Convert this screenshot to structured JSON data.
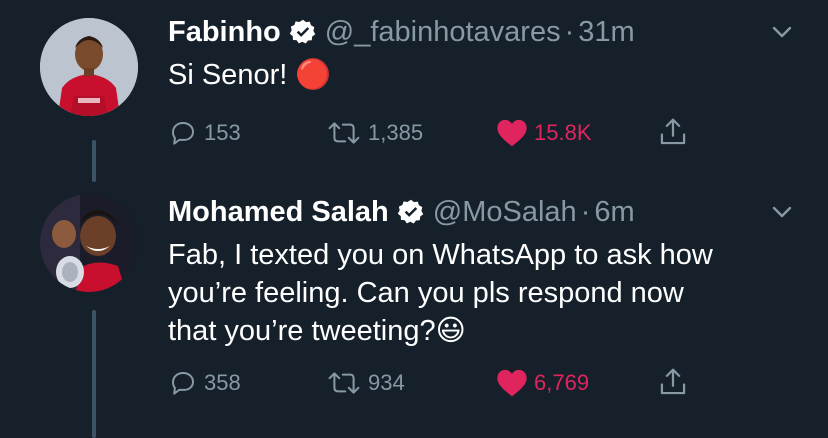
{
  "tweets": [
    {
      "name": "Fabinho",
      "handle": "@_fabinhotavares",
      "time": "31m",
      "text": "Si Senor! 🔴",
      "replies": "153",
      "retweets": "1,385",
      "likes": "15.8K"
    },
    {
      "name": "Mohamed Salah",
      "handle": "@MoSalah",
      "time": "6m",
      "text_lines": [
        "Fab, I texted you on WhatsApp to ask how",
        "you’re feeling. Can you pls respond now",
        "that you’re tweeting?😃"
      ],
      "replies": "358",
      "retweets": "934",
      "likes": "6,769"
    }
  ],
  "separator": "·",
  "colors": {
    "background": "#15202b",
    "secondary_text": "#8899a6",
    "like": "#e0245e",
    "verified": "#ffffff",
    "thread_line": "#3d5466"
  },
  "icons": [
    "verified-badge-icon",
    "chevron-down-icon",
    "reply-icon",
    "retweet-icon",
    "heart-icon",
    "share-icon"
  ]
}
